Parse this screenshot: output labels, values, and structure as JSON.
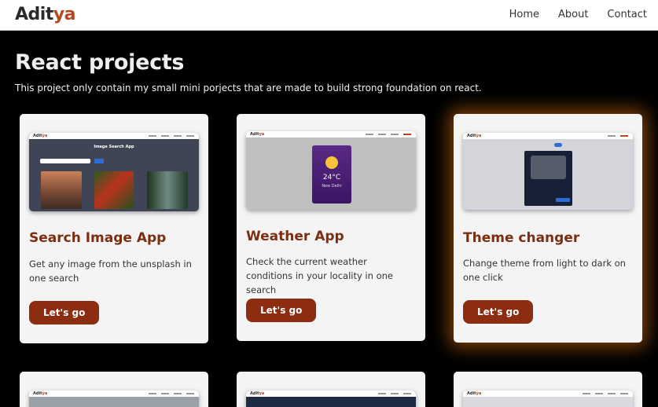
{
  "nav": {
    "brand_part1": "Adit",
    "brand_part2": "ya",
    "links": [
      "Home",
      "About",
      "Contact"
    ]
  },
  "header": {
    "title": "React projects",
    "subtitle": "This project only contain my small mini porjects that are made to build strong foundation on react."
  },
  "cards": [
    {
      "title": "Search Image App",
      "description": "Get any image from the unsplash in one search",
      "button": "Let's go",
      "preview_heading": "Image Search App"
    },
    {
      "title": "Weather App",
      "description": "Check the current weather conditions in your locality in one search",
      "button": "Let's go",
      "preview_temp": "24°C",
      "preview_city": "New Delhi"
    },
    {
      "title": "Theme changer",
      "description": "Change theme from light to dark on one click",
      "button": "Let's go"
    }
  ],
  "colors": {
    "accent": "#8c2d12",
    "title": "#7a2e12",
    "brand_highlight": "#b5461e",
    "glow": "#e87614"
  }
}
